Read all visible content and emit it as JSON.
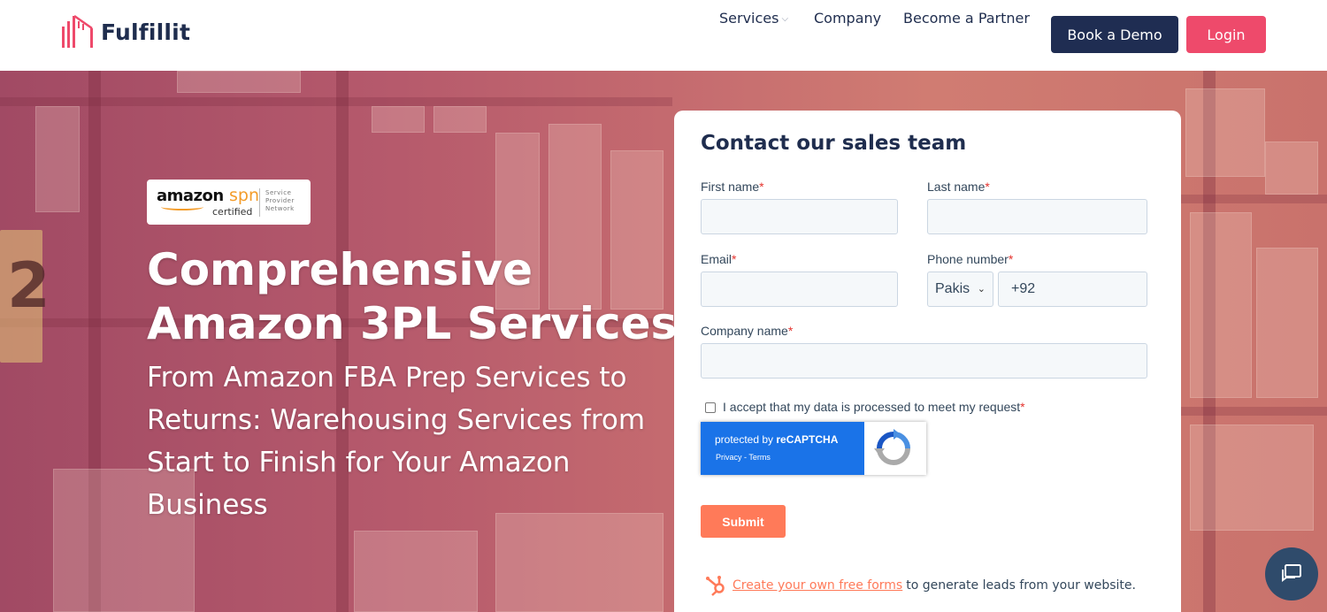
{
  "header": {
    "logo_text": "Fulfillit",
    "nav": {
      "services": "Services",
      "company": "Company",
      "partner": "Become a Partner"
    },
    "book_demo": "Book a Demo",
    "login": "Login"
  },
  "hero": {
    "badge": {
      "brand": "amazon",
      "spn": "spn",
      "certified": "certified",
      "network_line1": "Service",
      "network_line2": "Provider",
      "network_line3": "Network"
    },
    "sign_number": "2",
    "title_line1": "Comprehensive",
    "title_line2": "Amazon 3PL Services",
    "subtitle": "From Amazon FBA Prep Services to Returns: Warehousing Services from Start to Finish for Your Amazon Business"
  },
  "form": {
    "title": "Contact our sales team",
    "first_name_label": "First name",
    "last_name_label": "Last name",
    "email_label": "Email",
    "phone_label": "Phone number",
    "country_value": "Pakis",
    "phone_value": "+92",
    "company_label": "Company name",
    "required_mark": "*",
    "consent_label": "I accept that my data is processed to meet my request",
    "recaptcha_protected": "protected by ",
    "recaptcha_brand": "reCAPTCHA",
    "recaptcha_links": "Privacy - Terms",
    "submit": "Submit",
    "hubspot_link": "Create your own free forms",
    "hubspot_rest": "to generate leads from your website."
  },
  "colors": {
    "navy": "#1f2d52",
    "pink": "#ee4a6b",
    "hubspot_orange": "#ff7a59",
    "recaptcha_blue": "#1a73e8"
  }
}
